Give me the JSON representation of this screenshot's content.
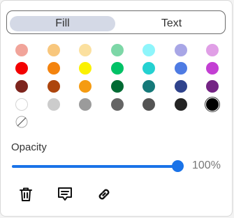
{
  "tabs": {
    "fill": "Fill",
    "text": "Text",
    "active": "Fill"
  },
  "palette": [
    [
      "#f1a49a",
      "#f8c77d",
      "#fbe09f",
      "#7dd7a7",
      "#8ef5fb",
      "#a8a6e6",
      "#e09fe6"
    ],
    [
      "#f30000",
      "#f4830d",
      "#fbf101",
      "#00c266",
      "#24d1d1",
      "#4e7be3",
      "#c33fd3"
    ],
    [
      "#7d241d",
      "#ad450d",
      "#f59b11",
      "#006a33",
      "#157979",
      "#2f438c",
      "#742484"
    ],
    [
      "#ffffff",
      "#cccccc",
      "#9b9b9b",
      "#656565",
      "#545454",
      "#242424",
      "#000000"
    ]
  ],
  "selected_color": "#000000",
  "none_swatch_icon": "no-fill-icon",
  "opacity": {
    "label": "Opacity",
    "value": 1.0,
    "display": "100%"
  },
  "actions": [
    {
      "icon": "trash-icon"
    },
    {
      "icon": "comment-icon"
    },
    {
      "icon": "link-icon"
    }
  ]
}
